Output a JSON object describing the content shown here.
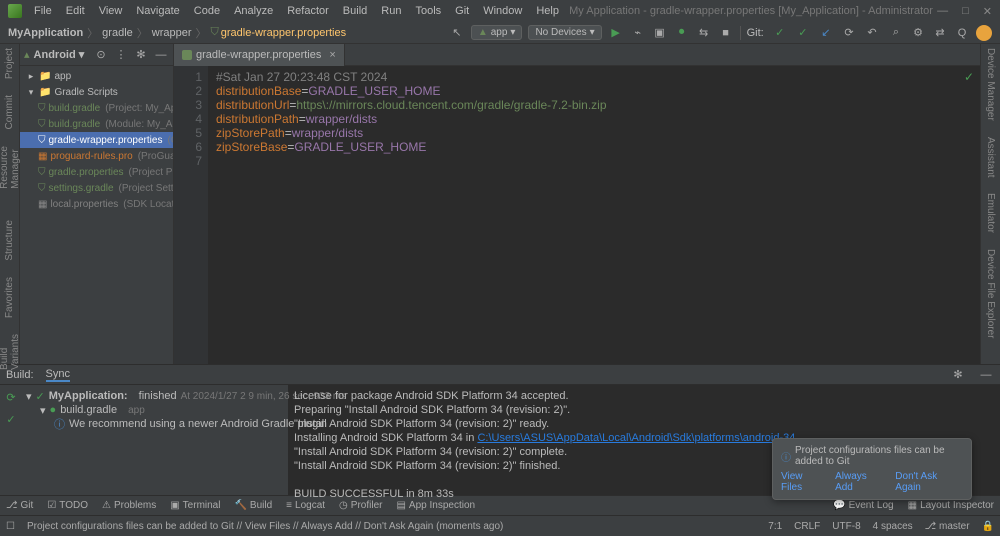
{
  "title_bar": {
    "menus": [
      "File",
      "Edit",
      "View",
      "Navigate",
      "Code",
      "Analyze",
      "Refactor",
      "Build",
      "Run",
      "Tools",
      "Git",
      "Window",
      "Help"
    ],
    "title": "My Application - gradle-wrapper.properties [My_Application] - Administrator"
  },
  "breadcrumbs": {
    "items": [
      "MyApplication",
      "gradle",
      "wrapper",
      "gradle-wrapper.properties"
    ]
  },
  "toolbar": {
    "run_config": "app",
    "devices": "No Devices",
    "git_label": "Git:"
  },
  "project": {
    "combo": "Android",
    "tree": {
      "app": "app",
      "scripts": "Gradle Scripts",
      "items": [
        {
          "name": "build.gradle",
          "hint": "(Project: My_App",
          "cls": "gradle"
        },
        {
          "name": "build.gradle",
          "hint": "(Module: My_App",
          "cls": "gradle"
        },
        {
          "name": "gradle-wrapper.properties",
          "hint": "(Gr",
          "cls": "orange",
          "selected": true
        },
        {
          "name": "proguard-rules.pro",
          "hint": "(ProGuard",
          "cls": ""
        },
        {
          "name": "gradle.properties",
          "hint": "(Project Pro",
          "cls": "gradle"
        },
        {
          "name": "settings.gradle",
          "hint": "(Project Settin",
          "cls": "gradle"
        },
        {
          "name": "local.properties",
          "hint": "(SDK Location",
          "cls": "muted"
        }
      ]
    }
  },
  "left_rail": [
    "Project",
    "Commit",
    "Resource Manager"
  ],
  "right_rail": [
    "Device Manager",
    "Assistant",
    "Emulator",
    "Device File Explorer"
  ],
  "editor": {
    "tab": "gradle-wrapper.properties",
    "lines": {
      "1": {
        "comment": "#Sat Jan 27 20:23:48 CST 2024"
      },
      "2": {
        "key": "distributionBase",
        "val": "GRADLE_USER_HOME"
      },
      "3": {
        "key": "distributionUrl",
        "val": "https\\://mirrors.cloud.tencent.com/gradle/gradle-7.2-bin.zip"
      },
      "4": {
        "key": "distributionPath",
        "val": "wrapper/dists"
      },
      "5": {
        "key": "zipStorePath",
        "val": "wrapper/dists"
      },
      "6": {
        "key": "zipStoreBase",
        "val": "GRADLE_USER_HOME"
      }
    }
  },
  "build": {
    "header_build": "Build:",
    "header_sync": "Sync",
    "tree": {
      "root": "MyApplication:",
      "root_status": "finished",
      "root_time": "At 2024/1/27 2 9 min, 26 sec, 933 ms",
      "child1": "build.gradle",
      "child1_hint": "app",
      "child2": "We recommend using a newer Android Gradle plugin"
    },
    "output": {
      "l1": "License for package Android SDK Platform 34 accepted.",
      "l2": "Preparing \"Install Android SDK Platform 34 (revision: 2)\".",
      "l3": "\"Install Android SDK Platform 34 (revision: 2)\" ready.",
      "l4a": "Installing Android SDK Platform 34 in ",
      "l4b": "C:\\Users\\ASUS\\AppData\\Local\\Android\\Sdk\\platforms\\android-34",
      "l5": "\"Install Android SDK Platform 34 (revision: 2)\" complete.",
      "l6": "\"Install Android SDK Platform 34 (revision: 2)\" finished.",
      "l7": "",
      "l8": "BUILD SUCCESSFUL in 8m 33s"
    }
  },
  "notification": {
    "title": "Project configurations files can be added to Git",
    "links": [
      "View Files",
      "Always Add",
      "Don't Ask Again"
    ]
  },
  "bottom_tools": {
    "items": [
      "Git",
      "TODO",
      "Problems",
      "Terminal",
      "Build",
      "Logcat",
      "Profiler",
      "App Inspection"
    ],
    "right": [
      "Event Log",
      "Layout Inspector"
    ]
  },
  "status_bar": {
    "msg": "Project configurations files can be added to Git // View Files // Always Add // Don't Ask Again (moments ago)",
    "pos": "7:1",
    "eol": "CRLF",
    "enc": "UTF-8",
    "indent": "4 spaces",
    "branch": "master"
  }
}
